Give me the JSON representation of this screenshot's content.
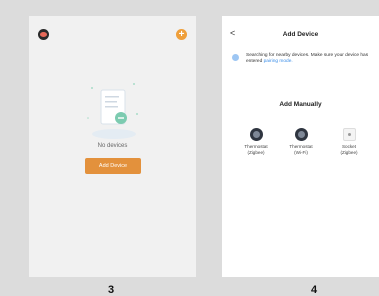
{
  "screen3": {
    "empty_text": "No devices",
    "add_button": "Add Device"
  },
  "screen4": {
    "back": "<",
    "title": "Add Device",
    "search_text": "Searching for nearby devices. Make sure your device has entered",
    "search_link": "pairing mode.",
    "manual_title": "Add Manually",
    "devices": [
      {
        "name": "Thermostat",
        "sub": "(Zigbee)",
        "icon": "thermostat-icon"
      },
      {
        "name": "Thermostat",
        "sub": "(Wi-Fi)",
        "icon": "thermostat-icon"
      },
      {
        "name": "Socket",
        "sub": "(Zigbee)",
        "icon": "socket-icon"
      }
    ]
  },
  "labels": {
    "left": "3",
    "right": "4"
  },
  "colors": {
    "accent": "#e3913c",
    "plus": "#ef9f3a",
    "link": "#3b8ee8"
  }
}
